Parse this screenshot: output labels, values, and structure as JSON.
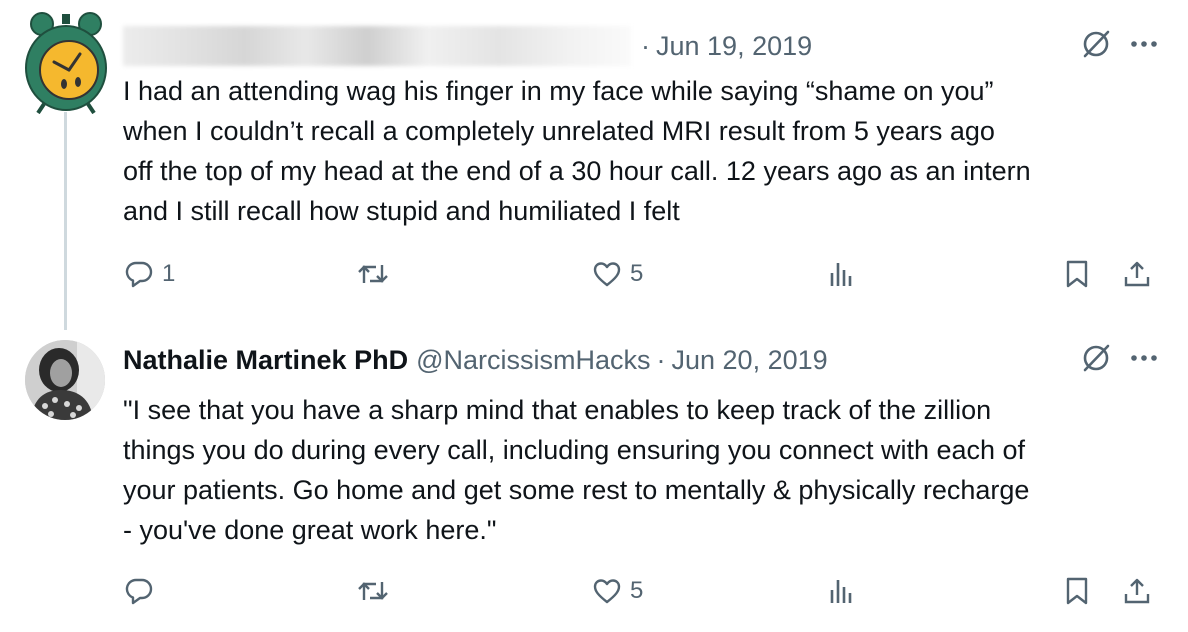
{
  "tweets": [
    {
      "author_name": "",
      "handle": "",
      "separator": "·",
      "date": "Jun 19, 2019",
      "text_lines": [
        "I had an attending wag his finger in my face while saying “shame on you”",
        "when I couldn’t recall a completely unrelated MRI result from 5 years ago",
        "off the top of my head at the end of a 30 hour call. 12 years ago as an intern",
        "and I still recall how stupid and humiliated I felt"
      ],
      "reply_count": "1",
      "retweet_count": "",
      "like_count": "5",
      "avatar_icon": "alarm-clock-face-icon"
    },
    {
      "author_name": "Nathalie Martinek PhD",
      "handle": "@NarcissismHacks",
      "separator": "·",
      "date": "Jun 20, 2019",
      "text_lines": [
        "\"I see that you have a sharp mind that enables to keep track of the zillion",
        "things you do during every call, including ensuring you connect with each of",
        "your patients. Go home and get some rest to mentally & physically recharge",
        "- you've done great work here.\""
      ],
      "reply_count": "",
      "retweet_count": "",
      "like_count": "5",
      "avatar_icon": "profile-photo"
    }
  ],
  "icons": {
    "grok": "grok-icon",
    "more": "more-icon",
    "reply": "reply-icon",
    "retweet": "retweet-icon",
    "like": "heart-icon",
    "views": "views-icon",
    "bookmark": "bookmark-icon",
    "share": "share-icon"
  },
  "colors": {
    "text": "#0f1419",
    "secondary": "#536471",
    "thread_line": "#cfd9de",
    "clock_green": "#2f7f62",
    "clock_face": "#f5b82e"
  }
}
